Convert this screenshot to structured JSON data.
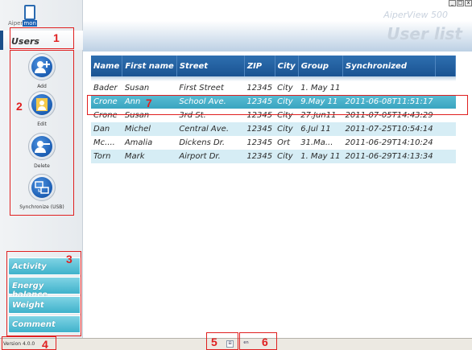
{
  "window": {
    "app_name": "AiperView 500",
    "logo_text_a": "Aiper",
    "logo_text_b": "mon",
    "buttons": [
      "_",
      "□",
      "x"
    ]
  },
  "sidebar": {
    "users_label": "Users",
    "actions": [
      {
        "label": "Add",
        "icon": "user-add-icon"
      },
      {
        "label": "Edit",
        "icon": "user-edit-icon"
      },
      {
        "label": "Delete",
        "icon": "user-delete-icon"
      },
      {
        "label": "Synchronize (USB)",
        "icon": "sync-usb-icon"
      }
    ],
    "menu": [
      {
        "label": "Activity"
      },
      {
        "label": "Energy balance"
      },
      {
        "label": "Weight"
      },
      {
        "label": "Comment"
      }
    ]
  },
  "main": {
    "title": "User list",
    "table": {
      "columns": [
        "Name",
        "First name",
        "Street",
        "ZIP",
        "City",
        "Group",
        "Synchronized"
      ],
      "rows": [
        [
          "Bader",
          "Susan",
          "First Street",
          "12345",
          "City",
          "1. May 11",
          ""
        ],
        [
          "Crone",
          "Ann",
          "School Ave.",
          "12345",
          "City",
          "9.May 11",
          "2011-06-08T11:51:17"
        ],
        [
          "Crone",
          "Susan",
          "3rd St.",
          "12345",
          "City",
          "27.Jun11",
          "2011-07-05T14:43:29"
        ],
        [
          "Dan",
          "Michel",
          "Central Ave.",
          "12345",
          "City",
          "6.Jul 11",
          "2011-07-25T10:54:14"
        ],
        [
          "Mc....",
          "Amalia",
          "Dickens Dr.",
          "12345",
          "Ort",
          "31.Ma...",
          "2011-06-29T14:10:24"
        ],
        [
          "Torn",
          "Mark",
          "Airport Dr.",
          "12345",
          "City",
          "1. May 11",
          "2011-06-29T14:13:34"
        ]
      ],
      "selected_row": 1
    }
  },
  "statusbar": {
    "version": "Version 4.0.0",
    "icon_a": "⊞",
    "icon_b": "en"
  },
  "annotations": [
    "1",
    "2",
    "3",
    "4",
    "5",
    "6",
    "7"
  ],
  "colors": {
    "header_blue": "#1a5392",
    "selected_row": "#3aa5c0",
    "menu_cyan": "#3fb2cb",
    "annotation_red": "#e02020"
  }
}
